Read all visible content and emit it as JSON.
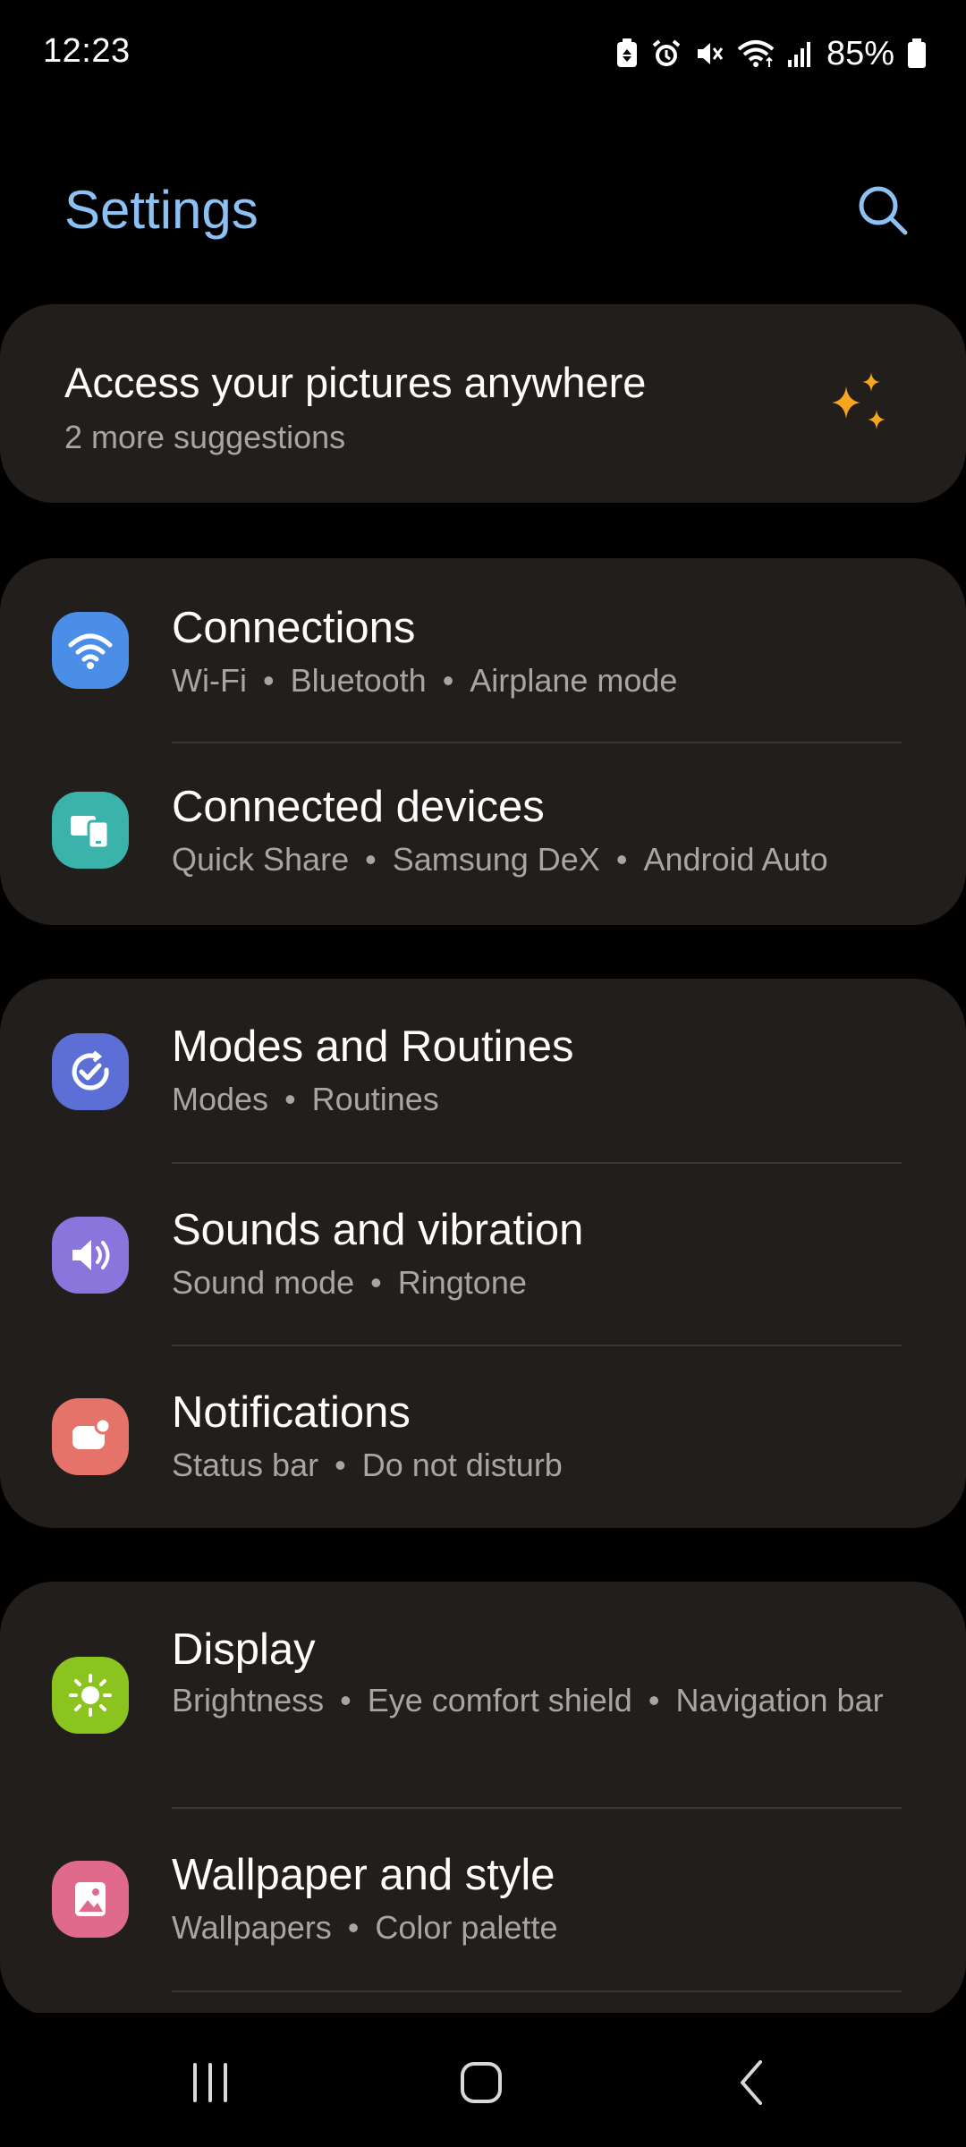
{
  "status_bar": {
    "time": "12:23",
    "battery": "85%",
    "icons": [
      "battery-saver-icon",
      "alarm-icon",
      "mute-icon",
      "wifi-icon",
      "signal-icon",
      "battery-icon"
    ]
  },
  "header": {
    "title": "Settings",
    "search_icon": "search-icon"
  },
  "suggestion": {
    "title": "Access your pictures anywhere",
    "subtitle": "2 more suggestions",
    "icon": "sparkle-icon",
    "icon_color": "#f7a51c"
  },
  "groups": [
    {
      "items": [
        {
          "title": "Connections",
          "subtitle": [
            "Wi-Fi",
            "Bluetooth",
            "Airplane mode"
          ],
          "icon": "wifi-icon",
          "color": "#4b8ee8"
        },
        {
          "title": "Connected devices",
          "subtitle": [
            "Quick Share",
            "Samsung DeX",
            "Android Auto"
          ],
          "icon": "devices-icon",
          "color": "#3ab4aa"
        }
      ]
    },
    {
      "items": [
        {
          "title": "Modes and Routines",
          "subtitle": [
            "Modes",
            "Routines"
          ],
          "icon": "routine-check-icon",
          "color": "#5b6fd6"
        },
        {
          "title": "Sounds and vibration",
          "subtitle": [
            "Sound mode",
            "Ringtone"
          ],
          "icon": "speaker-icon",
          "color": "#8a75dc"
        },
        {
          "title": "Notifications",
          "subtitle": [
            "Status bar",
            "Do not disturb"
          ],
          "icon": "notification-icon",
          "color": "#e5736a"
        }
      ]
    },
    {
      "items": [
        {
          "title": "Display",
          "subtitle": [
            "Brightness",
            "Eye comfort shield",
            "Navigation bar"
          ],
          "icon": "sun-icon",
          "color": "#8cc41f"
        },
        {
          "title": "Wallpaper and style",
          "subtitle": [
            "Wallpapers",
            "Color palette"
          ],
          "icon": "wallpaper-icon",
          "color": "#e06a8c"
        }
      ]
    }
  ],
  "nav_bar": {
    "recents": "recents-icon",
    "home": "home-icon",
    "back": "back-icon"
  }
}
